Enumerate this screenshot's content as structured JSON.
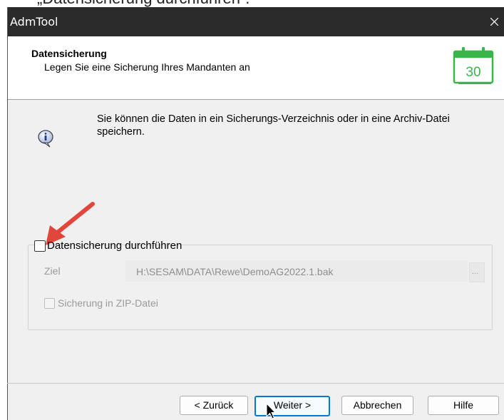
{
  "top_caption": "„Datensicherung durchführen“.",
  "window": {
    "title": "AdmTool"
  },
  "header": {
    "title": "Datensicherung",
    "subtitle": "Legen Sie eine Sicherung Ihres Mandanten an",
    "calendar_number": "30"
  },
  "info": {
    "text": "Sie können die Daten in ein Sicherungs-Verzeichnis oder in eine Archiv-Datei speichern."
  },
  "backup": {
    "checkbox_label": "Datensicherung durchführen",
    "checked": false,
    "target_label": "Ziel",
    "target_value": "H:\\SESAM\\DATA\\Rewe\\DemoAG2022.1.bak",
    "browse_label": "...",
    "zip_label": "Sicherung in ZIP-Datei",
    "zip_checked": false
  },
  "buttons": {
    "back": "< Zurück",
    "next": "Weiter >",
    "cancel": "Abbrechen",
    "help": "Hilfe"
  },
  "colors": {
    "accent": "#0078d4",
    "titlebar": "#2b2b2b",
    "calendar_green": "#39b54a",
    "annotation_arrow": "#e2453c"
  },
  "icons": [
    "close-icon",
    "calendar-icon",
    "info-icon",
    "annotation-arrow",
    "mouse-cursor"
  ]
}
